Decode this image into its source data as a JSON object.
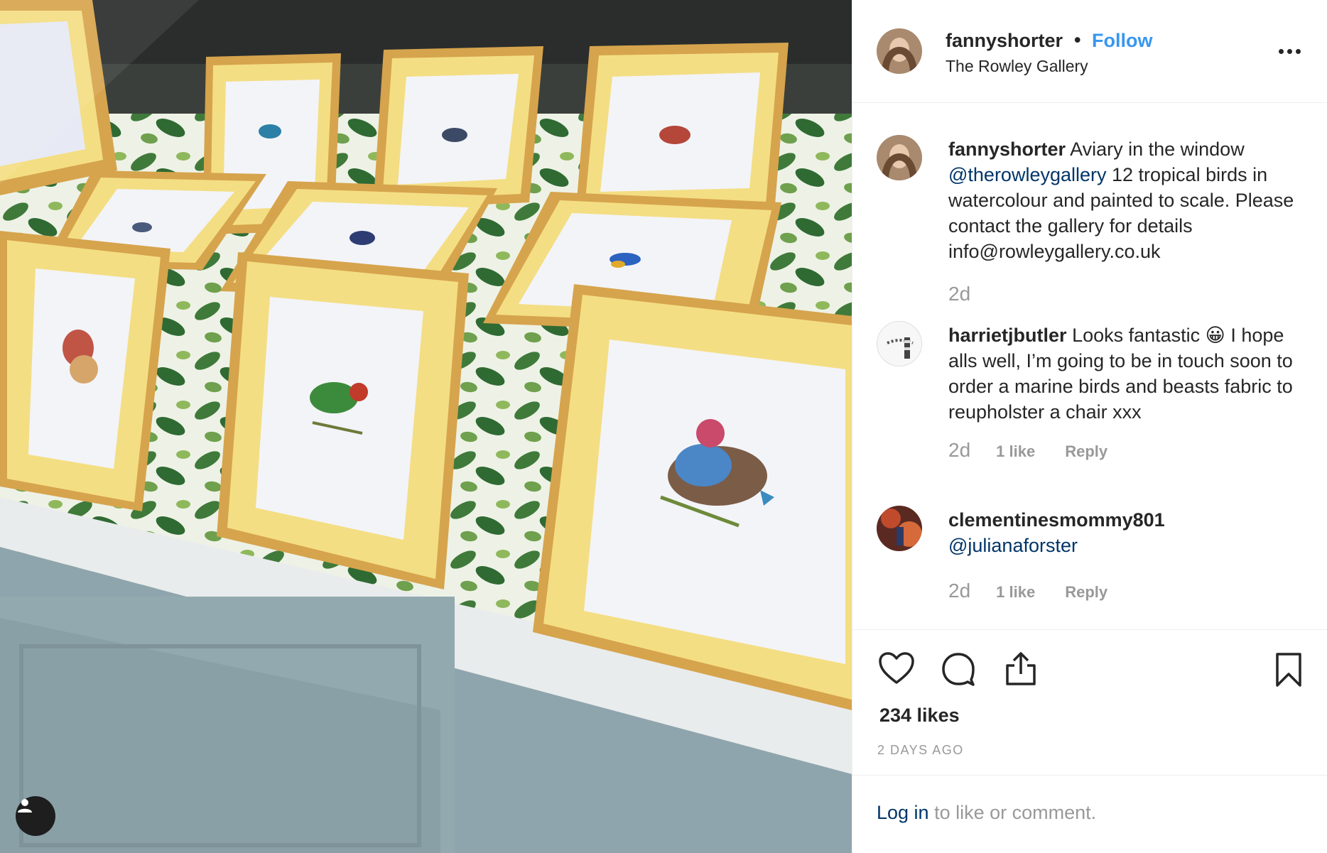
{
  "photo": {
    "alt_icon": "person-icon"
  },
  "header": {
    "username": "fannyshorter",
    "separator": "•",
    "follow_label": "Follow",
    "location": "The Rowley Gallery",
    "more_icon": "more-options-icon"
  },
  "comments": [
    {
      "username": "fannyshorter",
      "text_1": "Aviary in the window ",
      "mention": "@therowleygallery",
      "text_2": " 12 tropical birds in watercolour and painted to scale. Please contact the gallery for details info@rowleygallery.co.uk",
      "age": "2d"
    },
    {
      "username": "harrietjbutler",
      "text_1": "Looks fantastic ",
      "emoji": "😀",
      "text_2": " I hope alls well, I’m going to be in touch soon to order a marine birds and beasts fabric to reupholster a chair xxx",
      "age": "2d",
      "likes": "1 like",
      "reply": "Reply"
    },
    {
      "username": "clementinesmommy801",
      "mention": "@julianaforster",
      "age": "2d",
      "likes": "1 like",
      "reply": "Reply"
    }
  ],
  "actions": {
    "icons": [
      "heart-icon",
      "comment-icon",
      "share-icon",
      "bookmark-icon"
    ],
    "likes_count": "234 likes",
    "posted": "2 DAYS AGO"
  },
  "login": {
    "link": "Log in",
    "rest": " to like or comment."
  },
  "colors": {
    "link_blue": "#3897f0",
    "mention_navy": "#003569",
    "muted": "#999999",
    "text": "#262626",
    "frame_gold": "#d4a24a",
    "mat_yellow": "#f6e08a",
    "shelf_blue": "#8fa5ad"
  }
}
